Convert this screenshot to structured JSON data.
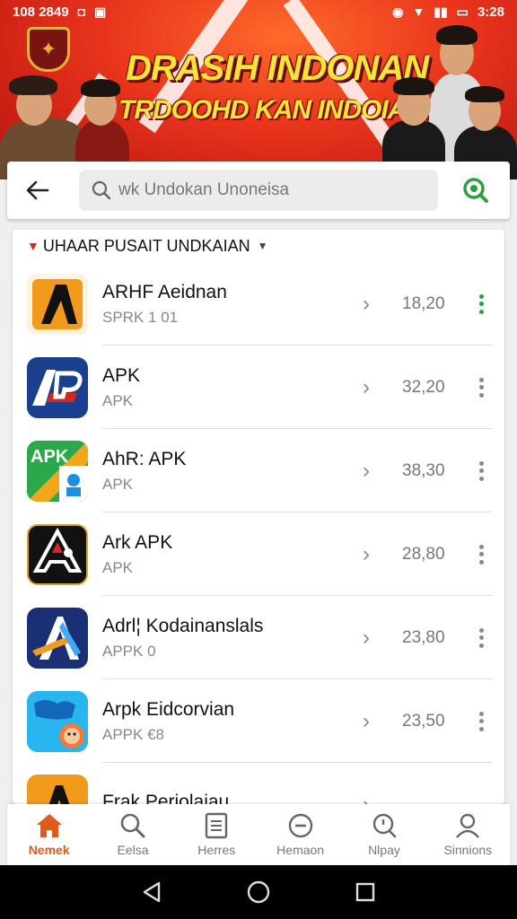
{
  "status_bar": {
    "time_left": "108 2849",
    "time_right": "3:28"
  },
  "banner": {
    "title": "DRASIH INDONAN",
    "subtitle": "TRDOOHD KAN INDOIASA!",
    "colors": {
      "background": "#e8341c",
      "title": "#f7e43a"
    }
  },
  "search": {
    "back_icon": "arrow-left-icon",
    "placeholder": "wk Undokan Unoneisa",
    "action_icon": "search-icon",
    "action_color": "#2e9e3e"
  },
  "list": {
    "header": "UHAAR PUSAIT UNDKAIAN",
    "items": [
      {
        "title": "ARHF Aeidnan",
        "subtitle": "SPRK 1 01",
        "size": "18,20",
        "icon": "a-letter-orange"
      },
      {
        "title": "APK",
        "subtitle": "APK",
        "size": "32,20",
        "icon": "ap-navy"
      },
      {
        "title": "AhR: APK",
        "subtitle": "APK",
        "size": "38,30",
        "icon": "apk-green"
      },
      {
        "title": "Ark APK",
        "subtitle": "APK",
        "size": "28,80",
        "icon": "a-black"
      },
      {
        "title": "Adrl¦ Kodainanslals",
        "subtitle": "APPK  0",
        "size": "23,80",
        "icon": "a-blue-arrow"
      },
      {
        "title": "Arpk Eidcorvian",
        "subtitle": "APPK  €8",
        "size": "23,50",
        "icon": "cyan-character"
      },
      {
        "title": "Frak Periolaiau",
        "subtitle": "",
        "size": "",
        "icon": "a-letter-orange"
      }
    ]
  },
  "bottom_nav": [
    {
      "label": "Nemek",
      "icon": "home-icon",
      "active": true
    },
    {
      "label": "Eelsa",
      "icon": "search-icon",
      "active": false
    },
    {
      "label": "Herres",
      "icon": "document-icon",
      "active": false
    },
    {
      "label": "Hemaon",
      "icon": "minus-circle-icon",
      "active": false
    },
    {
      "label": "Nlpay",
      "icon": "magnifier-icon",
      "active": false
    },
    {
      "label": "Sinnions",
      "icon": "profile-icon",
      "active": false
    }
  ],
  "accent_color": "#e05a1a"
}
